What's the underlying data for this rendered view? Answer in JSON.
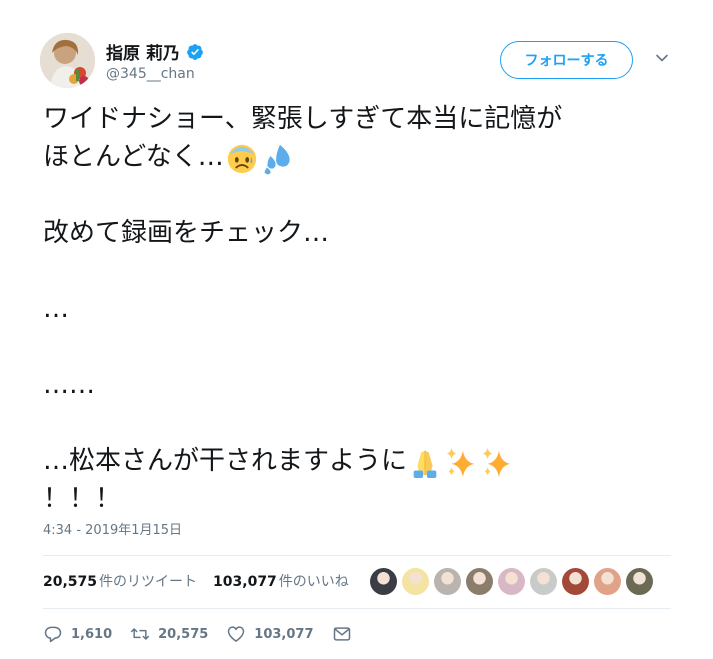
{
  "user": {
    "display_name": "指原 莉乃",
    "handle": "@345__chan",
    "verified": true
  },
  "follow_button_label": "フォローする",
  "tweet": {
    "lines": [
      "ワイドナショー、緊張しすぎて本当に記憶が",
      "ほとんどなく…",
      "",
      "改めて録画をチェック…",
      "",
      "…",
      "",
      "……",
      "",
      "…松本さんが干されますように",
      "！！！"
    ],
    "emojis": {
      "line2": [
        "anxious-face-emoji",
        "sweat-droplets-emoji"
      ],
      "line10": [
        "folded-hands-emoji",
        "sparkles-emoji",
        "sparkles-emoji"
      ]
    },
    "timestamp": "4:34 - 2019年1月15日"
  },
  "stats": {
    "retweets_count": "20,575",
    "retweets_label": "件のリツイート",
    "likes_count": "103,077",
    "likes_label": "件のいいね"
  },
  "liker_avatars": [
    "#3a3d45",
    "#f4e3a1",
    "#b9b4ad",
    "#8b7d6b",
    "#d9b8c6",
    "#c9cbc8",
    "#a24a3a",
    "#e0a38a",
    "#6a6a55"
  ],
  "actions": {
    "replies": "1,610",
    "retweets": "20,575",
    "likes": "103,077"
  },
  "colors": {
    "accent": "#1da1f2",
    "secondary_text": "#657786"
  }
}
